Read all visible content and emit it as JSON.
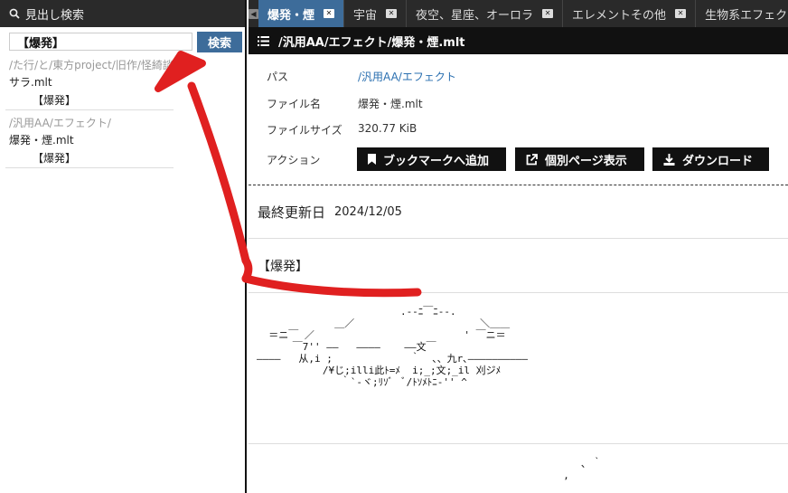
{
  "left_panel": {
    "title": "見出し検索",
    "search": {
      "value": "【爆発】",
      "button": "検索"
    },
    "results": [
      {
        "path": "/た行/と/東方project/旧作/怪綺談",
        "file": "サラ.mlt",
        "tag": "【爆発】"
      },
      {
        "path": "/汎用AA/エフェクト/",
        "file": "爆発・煙.mlt",
        "tag": "【爆発】"
      }
    ]
  },
  "tabs": [
    {
      "label": "爆発・煙",
      "active": true
    },
    {
      "label": "宇宙",
      "active": false
    },
    {
      "label": "夜空、星座、オーロラ",
      "active": false
    },
    {
      "label": "エレメントその他",
      "active": false
    },
    {
      "label": "生物系エフェクト",
      "active": false
    }
  ],
  "file_view": {
    "path_title": "/汎用AA/エフェクト/爆発・煙.mlt",
    "labels": {
      "path": "パス",
      "filename": "ファイル名",
      "filesize": "ファイルサイズ",
      "action": "アクション"
    },
    "path_link": "/汎用AA/エフェクト",
    "filename": "爆発・煙.mlt",
    "filesize": "320.77 KiB",
    "actions": {
      "bookmark": "ブックマークへ追加",
      "open_page": "個別ページ表示",
      "download": "ダウンロード"
    },
    "updated_label": "最終更新日",
    "updated_value": "2024/12/05",
    "section_tag": "【爆発】",
    "ascii_art": "                        .--ﾆ￣ﾆ--.\n             ＿／                     ＼＿＿\n  ＝ニ￣ ／                         ' ￣ニ＝\n      ￣7'' ――   ――――    ――文￣\n――――   从,i ;             ｀  、、九r､――――――――――\n           /¥じ;illi此ﾄ=ﾒ  i;_;文;_il 刈ジﾒ\n              ｀`-ヾ;ﾘｿﾞ  ﾞ/ﾄｿﾒﾄﾆ-'' ^",
    "ascii_art_2": "     ､ ｀\n  ,"
  },
  "colors": {
    "accent": "#3d6c9a",
    "dark": "#2a2a2a",
    "link": "#2a6fb0",
    "annotation": "#e02020"
  }
}
